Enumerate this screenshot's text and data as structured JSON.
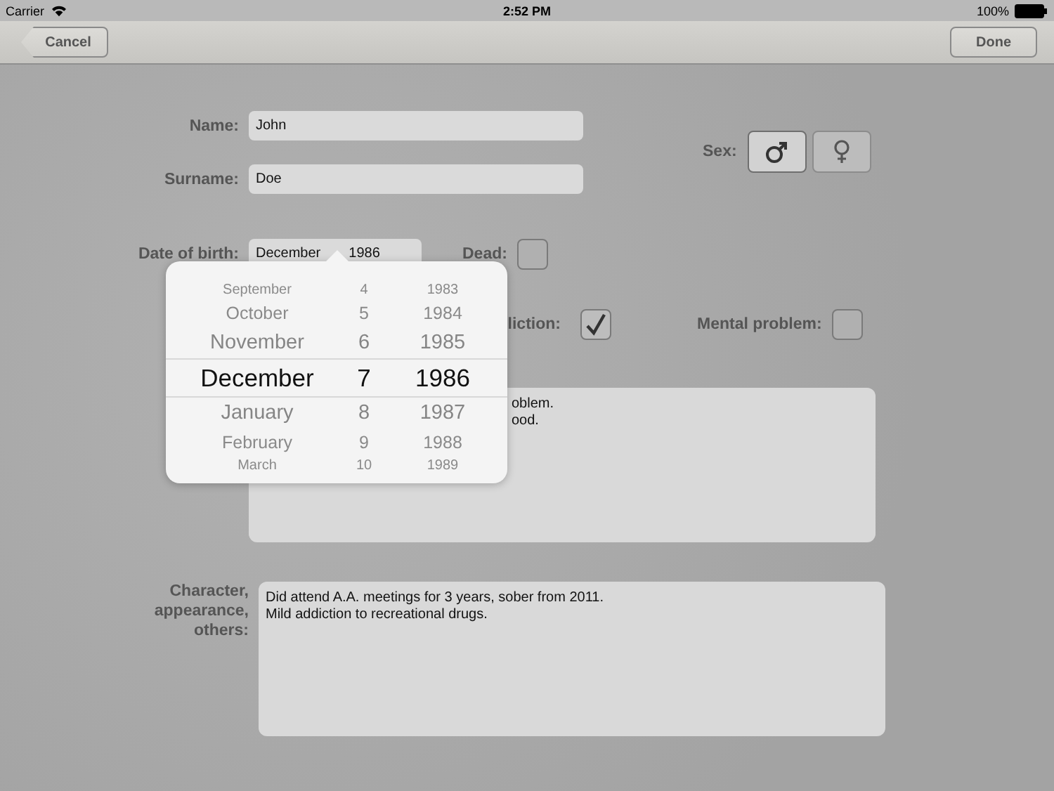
{
  "status_bar": {
    "carrier": "Carrier",
    "time": "2:52 PM",
    "battery": "100%"
  },
  "nav_bar": {
    "back_button": "Cancel",
    "done_button": "Done"
  },
  "form": {
    "name": {
      "label": "Name:",
      "value": "John"
    },
    "surname": {
      "label": "Surname:",
      "value": "Doe"
    },
    "sex": {
      "label": "Sex:",
      "options": [
        {
          "kind": "male",
          "selected": true
        },
        {
          "kind": "female",
          "selected": false
        }
      ]
    },
    "date_of_birth": {
      "label": "Date of birth:",
      "value_parts": [
        "December",
        "1986"
      ]
    },
    "dead": {
      "label": "Dead:",
      "checked": false
    },
    "addiction": {
      "label": "liction:",
      "checked": true
    },
    "mental_problem": {
      "label": "Mental problem:",
      "checked": false
    },
    "notes": {
      "lines": [
        "oblem.",
        "ood."
      ]
    },
    "character": {
      "label": "Character, appearance, others:",
      "lines": [
        "Did attend A.A. meetings for 3 years, sober from 2011.",
        "Mild addiction to recreational drugs."
      ]
    }
  },
  "date_picker": {
    "rows": [
      {
        "month": "September",
        "day": "4",
        "year": "1983",
        "selected": false
      },
      {
        "month": "October",
        "day": "5",
        "year": "1984",
        "selected": false
      },
      {
        "month": "November",
        "day": "6",
        "year": "1985",
        "selected": false
      },
      {
        "month": "December",
        "day": "7",
        "year": "1986",
        "selected": true
      },
      {
        "month": "January",
        "day": "8",
        "year": "1987",
        "selected": false
      },
      {
        "month": "February",
        "day": "9",
        "year": "1988",
        "selected": false
      },
      {
        "month": "March",
        "day": "10",
        "year": "1989",
        "selected": false
      }
    ]
  }
}
